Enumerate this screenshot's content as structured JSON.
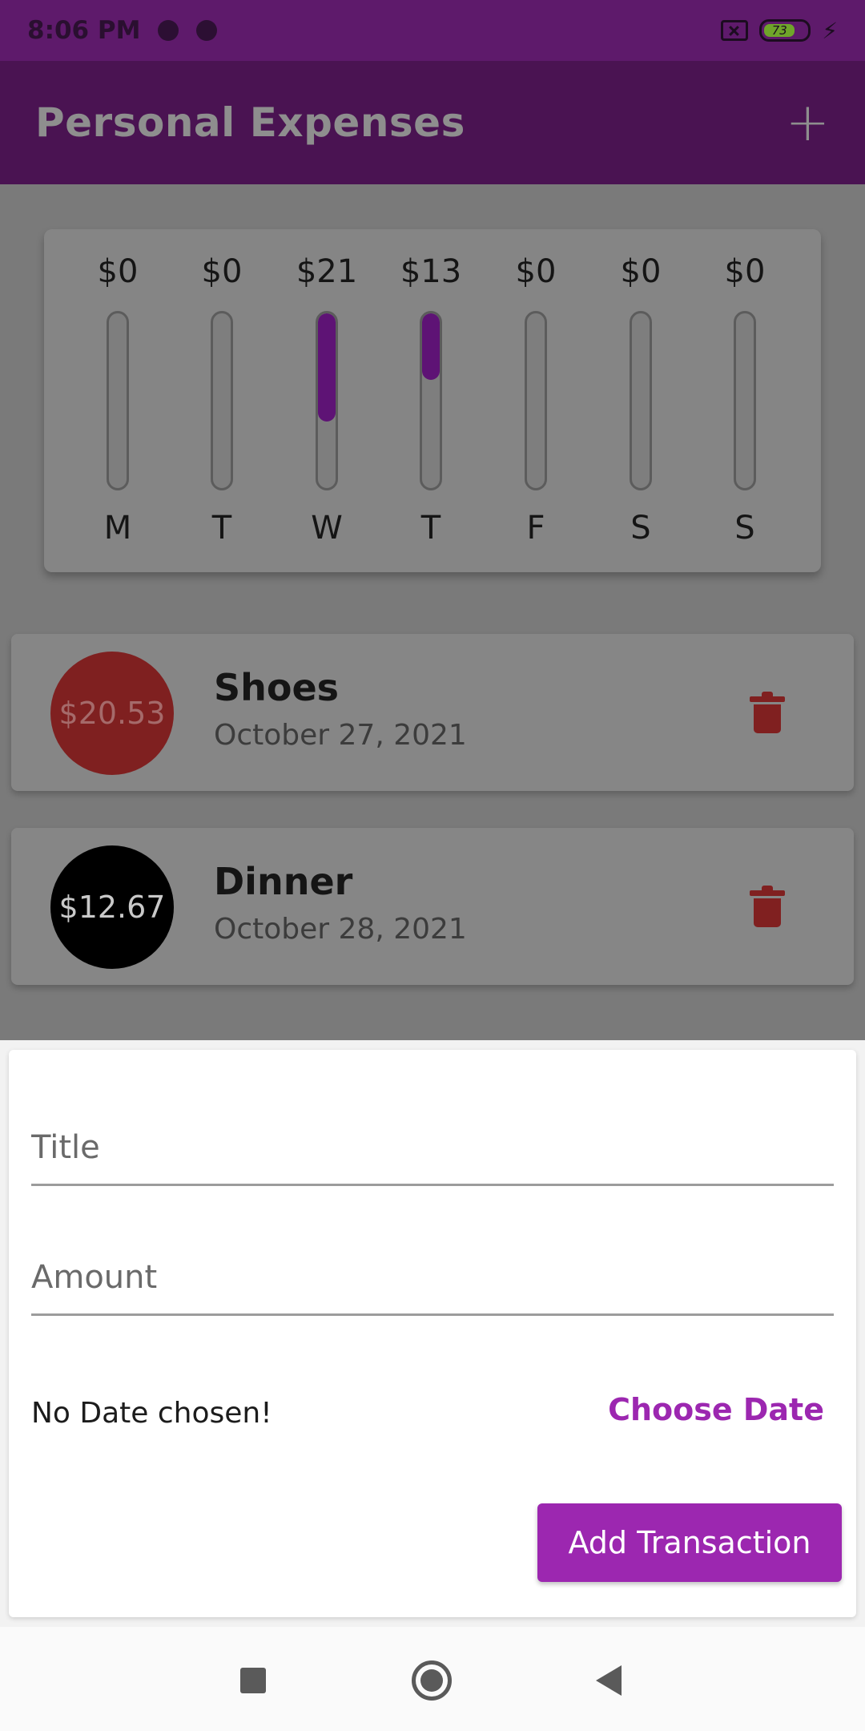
{
  "status_bar": {
    "time": "8:06 PM",
    "battery": "73"
  },
  "app_bar": {
    "title": "Personal Expenses",
    "add_label": "+"
  },
  "chart_data": {
    "type": "bar",
    "categories": [
      "M",
      "T",
      "W",
      "T",
      "F",
      "S",
      "S"
    ],
    "labels": [
      "$0",
      "$0",
      "$21",
      "$13",
      "$0",
      "$0",
      "$0"
    ],
    "values": [
      0,
      0,
      21,
      13,
      0,
      0,
      0
    ],
    "fill_fraction": [
      0,
      0,
      0.62,
      0.38,
      0,
      0,
      0
    ]
  },
  "transactions": [
    {
      "amount": "$20.53",
      "title": "Shoes",
      "date": "October 27, 2021",
      "color": "#7f2020",
      "text_color": "#a56a6a"
    },
    {
      "amount": "$12.67",
      "title": "Dinner",
      "date": "October 28, 2021",
      "color": "#000000",
      "text_color": "#c9c9c9"
    }
  ],
  "form": {
    "title_placeholder": "Title",
    "amount_placeholder": "Amount",
    "no_date_text": "No Date chosen!",
    "choose_date_label": "Choose Date",
    "submit_label": "Add Transaction"
  },
  "colors": {
    "primary": "#9c27b0",
    "app_bar": "#4a1352",
    "status_bar": "#5e1a6b",
    "delete": "#802020"
  }
}
